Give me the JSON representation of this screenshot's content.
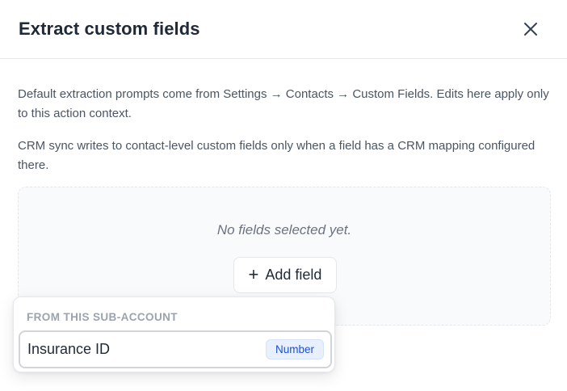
{
  "dialog": {
    "title": "Extract custom fields",
    "close_icon": "close-icon"
  },
  "description": {
    "paragraph1": "Default extraction prompts come from Settings → Contacts → Custom Fields. Edits here apply only to this action context.",
    "paragraph2": "CRM sync writes to contact-level custom fields only when a field has a CRM mapping configured there."
  },
  "fields": {
    "empty_text": "No fields selected yet.",
    "add_button_label": "Add field",
    "add_icon": "plus-icon"
  },
  "dropdown": {
    "section_heading": "FROM THIS SUB-ACCOUNT",
    "options": [
      {
        "label": "Insurance ID",
        "type": "Number"
      }
    ]
  },
  "colors": {
    "badge_bg": "#e8f0fd",
    "badge_text": "#1d4ed8"
  }
}
